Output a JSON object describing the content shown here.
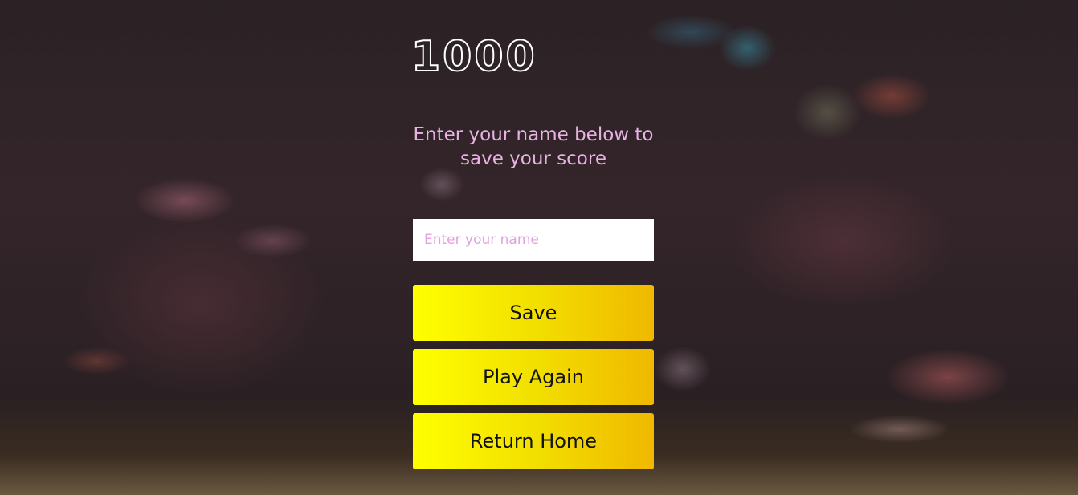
{
  "score": "1000",
  "prompt": "Enter your name below to save your score",
  "name_input": {
    "value": "",
    "placeholder": "Enter your name"
  },
  "buttons": {
    "save": "Save",
    "play_again": "Play Again",
    "return_home": "Return Home"
  },
  "colors": {
    "prompt_text": "#e8b3e3",
    "placeholder_text": "#e2a3dc",
    "button_gradient_start": "#ffff00",
    "button_gradient_end": "#f0b800",
    "score_text": "#ffffff"
  }
}
